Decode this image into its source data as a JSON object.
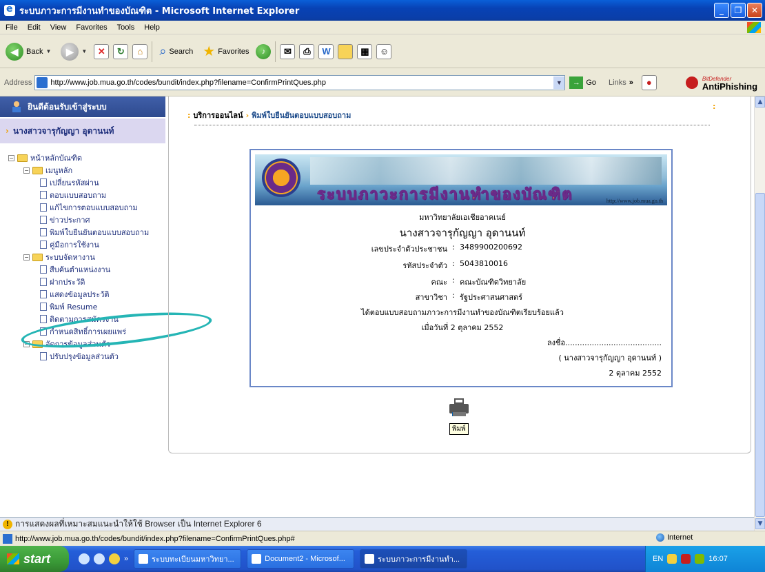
{
  "window": {
    "title": "ระบบภาวะการมีงานทำของบัณฑิต - Microsoft Internet Explorer",
    "buttons": [
      "_",
      "❐",
      "✕"
    ]
  },
  "menu": [
    "File",
    "Edit",
    "View",
    "Favorites",
    "Tools",
    "Help"
  ],
  "toolbar": {
    "back": "Back",
    "search": "Search",
    "favorites": "Favorites"
  },
  "address": {
    "label": "Address",
    "url": "http://www.job.mua.go.th/codes/bundit/index.php?filename=ConfirmPrintQues.php",
    "go": "Go",
    "links": "Links",
    "antiphishing_brand": "BitDefender",
    "antiphishing": "AntiPhishing"
  },
  "sidebar": {
    "welcome": "ยินดีต้อนรับเข้าสู่ระบบ",
    "user": "นางสาวจารุกัญญา อุดานนท์",
    "tree": {
      "root": "หน้าหลักบัณฑิต",
      "groups": [
        {
          "label": "เมนูหลัก",
          "items": [
            "เปลี่ยนรหัสผ่าน",
            "ตอบแบบสอบถาม",
            "แก้ไขการตอบแบบสอบถาม",
            "ข่าวประกาศ",
            "พิมพ์ใบยืนยันตอบแบบสอบถาม",
            "คู่มือการใช้งาน"
          ]
        },
        {
          "label": "ระบบจัดหางาน",
          "items": [
            "สืบค้นตำแหน่งงาน",
            "ฝากประวัติ",
            "แสดงข้อมูลประวัติ",
            "พิมพ์ Resume",
            "ติดตามการสมัครงาน",
            "กำหนดสิทธิ์การเผยแพร่"
          ]
        },
        {
          "label": "จัดการข้อมูลส่วนตัว",
          "items": [
            "ปรับปรุงข้อมูลส่วนตัว"
          ]
        }
      ]
    }
  },
  "breadcrumb": {
    "sep": ":",
    "first": "บริการออนไลน์",
    "arrow": "›",
    "second": "พิมพ์ใบยืนยันตอบแบบสอบถาม",
    "right_mark": ":"
  },
  "certificate": {
    "banner_title": "ระบบภาวะการมีงานทำของบัณฑิต",
    "banner_url": "http://www.job.mua.go.th",
    "university": "มหาวิทยาลัยเอเชียอาคเนย์",
    "name": "นางสาวจารุกัญญา  อุดานนท์",
    "fields": [
      {
        "label": "เลขประจำตัวประชาชน",
        "value": "3489900200692"
      },
      {
        "label": "รหัสประจำตัว",
        "value": "5043810016"
      },
      {
        "label": "คณะ",
        "value": "คณะบัณฑิตวิทยาลัย"
      },
      {
        "label": "สาขาวิชา",
        "value": "รัฐประศาสนศาสตร์"
      }
    ],
    "statement": "ได้ตอบแบบสอบถามภาวะการมีงานทำของบัณฑิตเรียบร้อยแล้ว",
    "date_line": "เมื่อวันที่ 2 ตุลาคม 2552",
    "sign_line": "ลงชื่อ........................................",
    "sign_name": "( นางสาวจารุกัญญา  อุดานนท์ )",
    "sign_date": "2 ตุลาคม 2552"
  },
  "print": {
    "tooltip": "พิมพ์"
  },
  "notice": "การแสดงผลที่เหมาะสมแนะนำให้ใช้ Browser เป็น Internet Explorer 6",
  "statusbar": {
    "url": "http://www.job.mua.go.th/codes/bundit/index.php?filename=ConfirmPrintQues.php#",
    "zone": "Internet"
  },
  "taskbar": {
    "start": "start",
    "tasks": [
      "ระบบทะเบียนมหาวิทยา...",
      "Document2 - Microsof...",
      "ระบบภาวะการมีงานทำ..."
    ],
    "lang": "EN",
    "clock": "16:07"
  }
}
